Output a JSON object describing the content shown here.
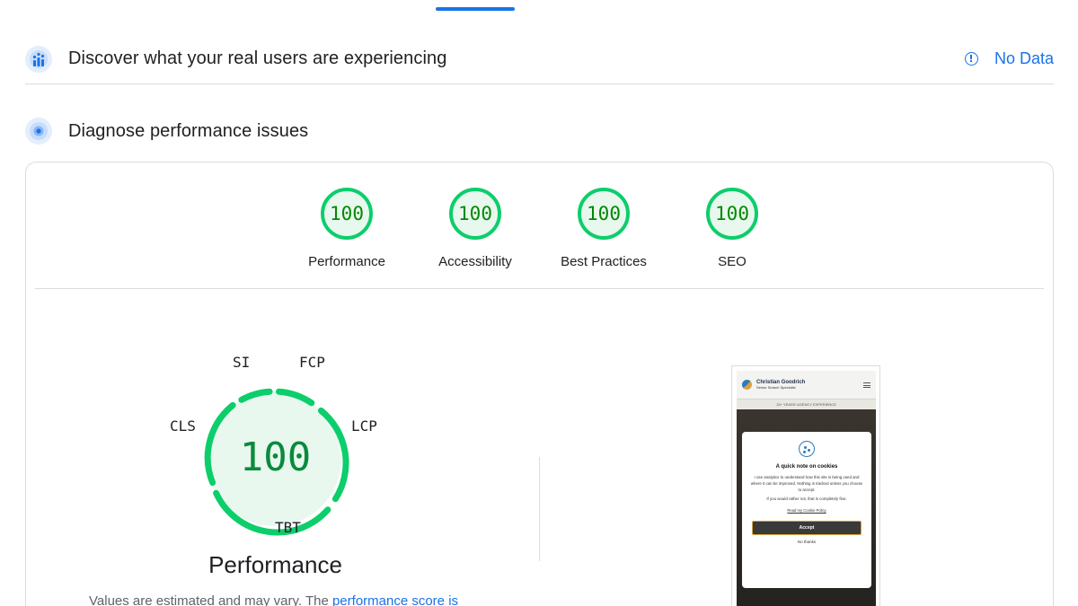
{
  "crux": {
    "title": "Discover what your real users are experiencing",
    "no_data": "No Data"
  },
  "diagnose": {
    "title": "Diagnose performance issues"
  },
  "categories": [
    {
      "score": "100",
      "label": "Performance"
    },
    {
      "score": "100",
      "label": "Accessibility"
    },
    {
      "score": "100",
      "label": "Best Practices"
    },
    {
      "score": "100",
      "label": "SEO"
    }
  ],
  "performance_gauge": {
    "score": "100",
    "label": "Performance",
    "metrics": {
      "si": "SI",
      "fcp": "FCP",
      "lcp": "LCP",
      "tbt": "TBT",
      "cls": "CLS"
    }
  },
  "footnote": {
    "text": "Values are estimated and may vary. The ",
    "link": "performance score is"
  },
  "preview": {
    "site_name": "Christian Goodrich",
    "site_subtitle": "Senior Search Specialist",
    "banner": "15+ YEARS' AGENCY EXPERIENCE",
    "cookie": {
      "title": "A quick note on cookies",
      "text1": "I use analytics to understand how this site is being used and where it can be improved. Nothing is tracked unless you choose to accept.",
      "text2": "If you would rather not, that is completely fine.",
      "link": "Read my Cookie Policy",
      "accept": "Accept",
      "decline": "No thanks"
    }
  },
  "colors": {
    "pass": "#0cce6b",
    "pass_text": "#008800",
    "link": "#1a73e8"
  }
}
